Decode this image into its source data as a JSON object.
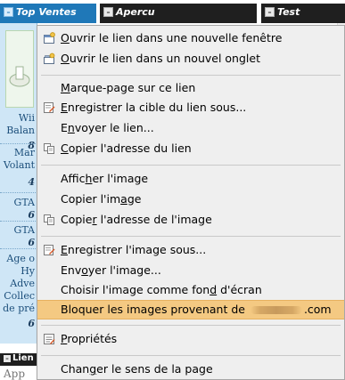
{
  "tabs": [
    {
      "label": "Top Ventes",
      "icon": "minus-icon",
      "active": true
    },
    {
      "label": "Apercu",
      "icon": "minus-icon",
      "active": false
    },
    {
      "label": "Test",
      "icon": "minus-icon",
      "active": false
    }
  ],
  "left_panel": {
    "items": [
      {
        "lines": [
          "Wii",
          "Balan"
        ],
        "number": "8"
      },
      {
        "lines": [
          "Mar",
          "Volant"
        ],
        "number": "4"
      },
      {
        "lines": [
          "GTA"
        ],
        "number": "6"
      },
      {
        "lines": [
          "GTA"
        ],
        "number": "6"
      },
      {
        "lines": [
          "Age o",
          "Hy",
          "Adve",
          "Collec",
          "de pré"
        ],
        "number": "6"
      }
    ]
  },
  "bottom": {
    "tab_label": "Lien",
    "text": "App"
  },
  "context_menu": {
    "items": [
      {
        "pre": "",
        "u": "O",
        "post": "uvrir le lien dans une nouvelle fenêtre",
        "icon": "new-window-icon"
      },
      {
        "pre": "",
        "u": "O",
        "post": "uvrir le lien dans un nouvel onglet",
        "icon": "new-tab-icon"
      },
      {
        "pre": "",
        "u": "M",
        "post": "arque-page sur ce lien",
        "icon": ""
      },
      {
        "pre": "",
        "u": "E",
        "post": "nregistrer la cible du lien sous...",
        "icon": "save-icon"
      },
      {
        "pre": "E",
        "u": "n",
        "post": "voyer le lien...",
        "icon": ""
      },
      {
        "pre": "",
        "u": "C",
        "post": "opier l'adresse du lien",
        "icon": "copy-icon"
      },
      {
        "pre": "Affic",
        "u": "h",
        "post": "er l'image",
        "icon": ""
      },
      {
        "pre": "Copier l'im",
        "u": "a",
        "post": "ge",
        "icon": ""
      },
      {
        "pre": "Copie",
        "u": "r",
        "post": " l'adresse de l'image",
        "icon": "copy-icon"
      },
      {
        "pre": "",
        "u": "E",
        "post": "nregistrer l'image sous...",
        "icon": "save-icon"
      },
      {
        "pre": "Env",
        "u": "o",
        "post": "yer l'image...",
        "icon": ""
      },
      {
        "pre": "Choisir l'image comme fon",
        "u": "d",
        "post": " d'écran",
        "icon": ""
      },
      {
        "pre": "Bloquer les images provenant de ",
        "u": "",
        "post": ".com",
        "icon": "",
        "highlighted": true,
        "redacted": true
      },
      {
        "pre": "",
        "u": "P",
        "post": "ropriétés",
        "icon": "properties-icon"
      },
      {
        "pre": "Chan",
        "u": "g",
        "post": "er le sens de la page",
        "icon": ""
      }
    ]
  }
}
